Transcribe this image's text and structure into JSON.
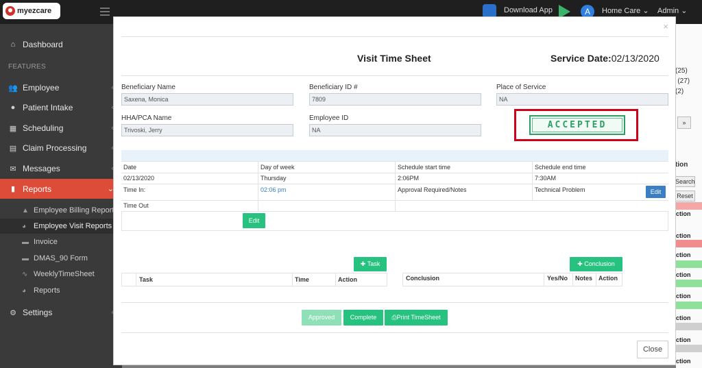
{
  "topbar": {
    "logo_text": "myezcare",
    "download_label": "Download App",
    "home_care_label": "Home Care",
    "admin_label": "Admin"
  },
  "sidebar": {
    "dashboard": "Dashboard",
    "features_header": "FEATURES",
    "items": [
      {
        "label": "Employee",
        "icon": "users-icon"
      },
      {
        "label": "Patient Intake",
        "icon": "user-icon"
      },
      {
        "label": "Scheduling",
        "icon": "calendar-icon"
      },
      {
        "label": "Claim Processing",
        "icon": "file-icon"
      },
      {
        "label": "Messages",
        "icon": "envelope-icon"
      },
      {
        "label": "Reports",
        "icon": "bar-chart-icon"
      }
    ],
    "report_subitems": [
      "Employee Billing Report",
      "Employee Visit Reports",
      "Invoice",
      "DMAS_90 Form",
      "WeeklyTimeSheet",
      "Reports"
    ],
    "settings": "Settings"
  },
  "background": {
    "counts": [
      "(25)",
      "d (27)",
      "(2)"
    ],
    "pager": "»",
    "tion": "tion",
    "search": "Search",
    "reset": "Reset",
    "action": "ction"
  },
  "modal": {
    "title": "Visit Time Sheet",
    "service_date_label": "Service Date:",
    "service_date": "02/13/2020",
    "fields": {
      "beneficiary_name_label": "Beneficiary Name",
      "beneficiary_name": "Saxena, Monica",
      "beneficiary_id_label": "Beneficiary ID #",
      "beneficiary_id": "7809",
      "place_label": "Place of Service",
      "place": "NA",
      "hha_label": "HHA/PCA Name",
      "hha": "Trivoski, Jerry",
      "employee_id_label": "Employee ID",
      "employee_id": "NA"
    },
    "stamp": "ACCEPTED",
    "visit": {
      "headers": [
        "Date",
        "Day of week",
        "Schedule start time",
        "Schedule end time"
      ],
      "values": [
        "02/13/2020",
        "Thursday",
        "2:06PM",
        "7:30AM"
      ],
      "time_in_label": "Time In:",
      "time_in": "02:06 pm",
      "approval_label": "Approval Required/Notes",
      "technical_problem": "Technical Problem",
      "edit_label": "Edit",
      "time_out_label": "Time Out",
      "edit2_label": "Edit"
    },
    "task_button": "Task",
    "conclusion_button": "Conclusion",
    "task_table_headers": [
      "Task",
      "Time",
      "Action"
    ],
    "conclusion_table_headers": [
      "Conclusion",
      "Yes/No",
      "Notes",
      "Action"
    ],
    "approved_button": "Approved",
    "complete_button": "Complete",
    "print_button": "Print TimeSheet",
    "close_button": "Close",
    "close_icon": "×"
  }
}
